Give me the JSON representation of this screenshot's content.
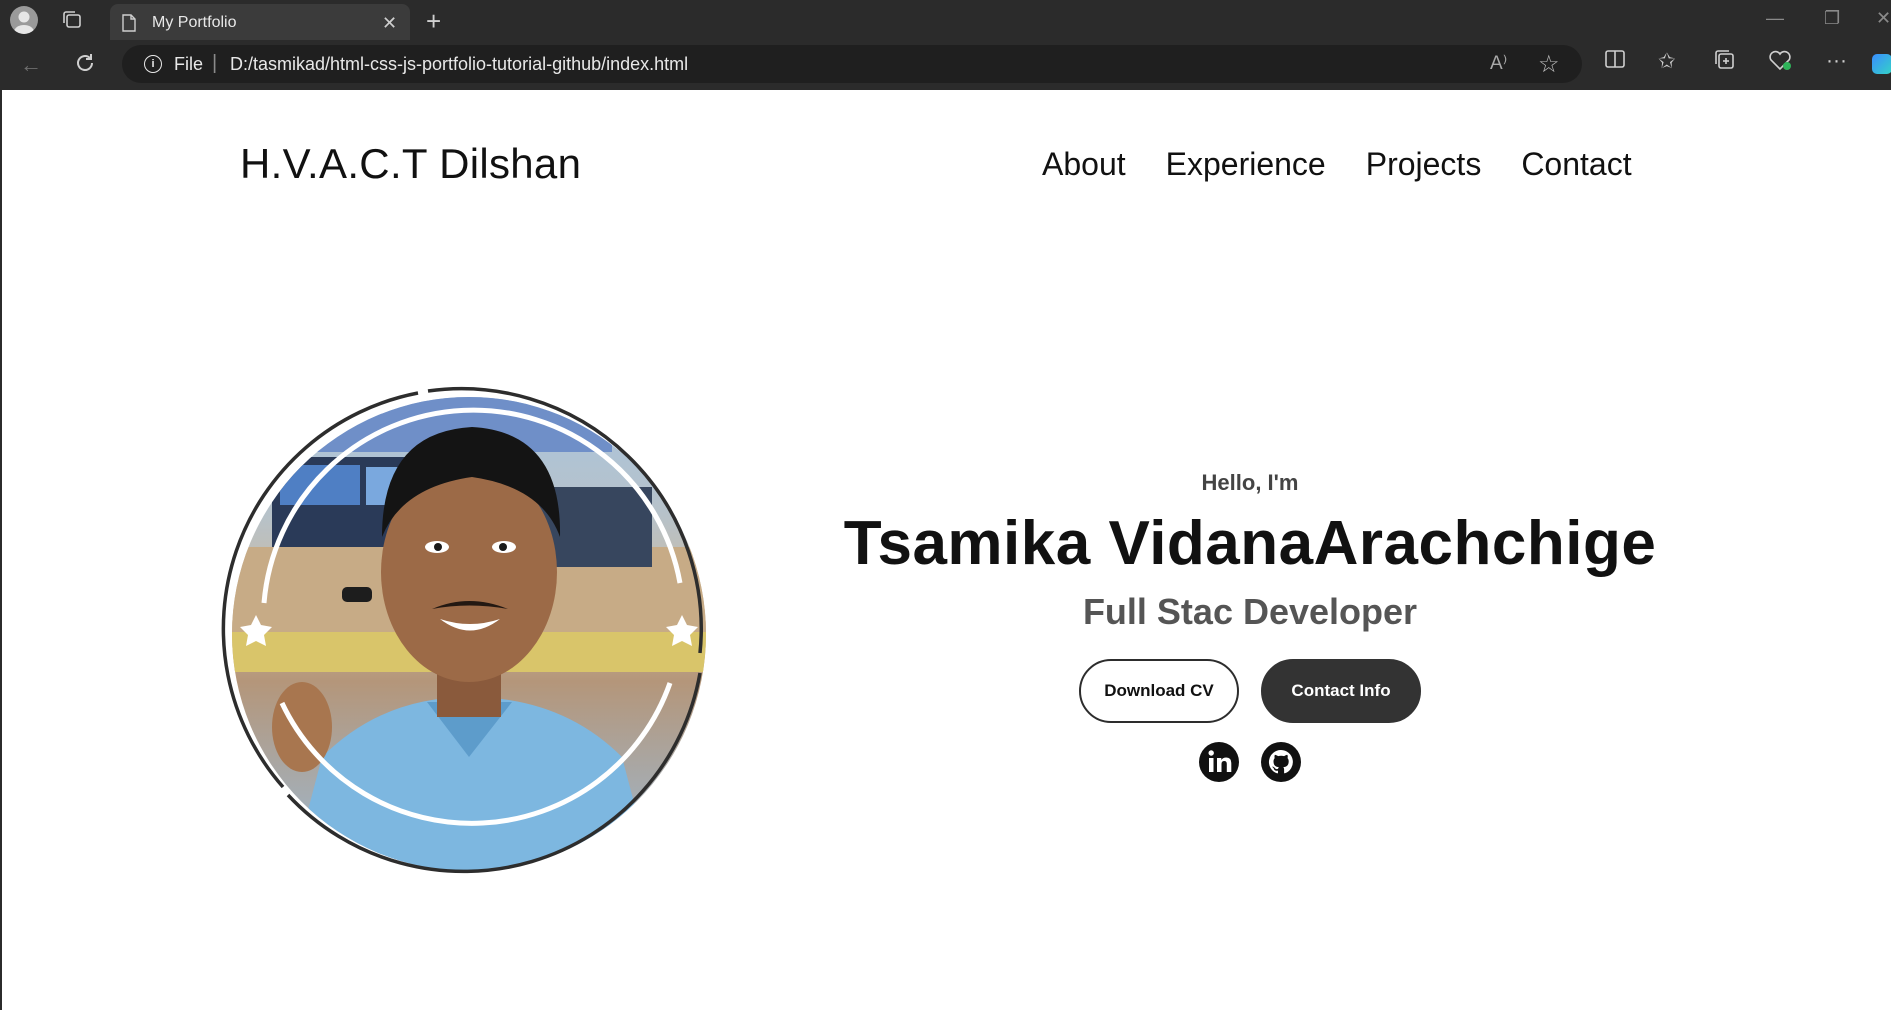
{
  "browser": {
    "tab_title": "My Portfolio",
    "address_prefix": "File",
    "address_sep": "|",
    "url": "D:/tasmikad/html-css-js-portfolio-tutorial-github/index.html",
    "read_aloud_label": "A⁾"
  },
  "page": {
    "logo": "H.V.A.C.T Dilshan",
    "nav": [
      "About",
      "Experience",
      "Projects",
      "Contact"
    ],
    "hero": {
      "greeting": "Hello, I'm",
      "name": "Tsamika VidanaArachchige",
      "role": "Full Stac Developer",
      "download_cv": "Download CV",
      "contact_info": "Contact Info"
    }
  },
  "icons": {
    "social": [
      "linkedin-icon",
      "github-icon"
    ]
  },
  "colors": {
    "chrome_bg": "#2b2b2b",
    "text_dark": "#111111",
    "button_solid": "#333333"
  }
}
